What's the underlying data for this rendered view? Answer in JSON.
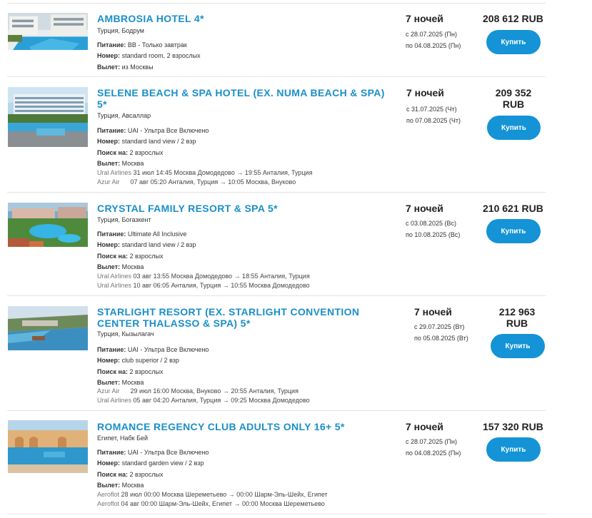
{
  "labels": {
    "meal": "Питание:",
    "room": "Номер:",
    "search": "Поиск на:",
    "departure": "Вылет:"
  },
  "hotels": [
    {
      "title": "AMBROSIA HOTEL 4*",
      "location": "Турция, Бодрум",
      "meal": "BB - Только завтрак",
      "room": "standard room, 2 взрослых",
      "departure": "из Москвы",
      "nights": "7 ночей",
      "date_from": "с 28.07.2025 (Пн)",
      "date_to": "по 04.08.2025 (Пн)",
      "price": "208 612 RUB",
      "buy_label": "Купить",
      "image_icon": "hotel-pool-photo"
    },
    {
      "title": "SELENE BEACH & SPA HOTEL (EX. NUMA BEACH & SPA) 5*",
      "location": "Турция, Авсаллар",
      "meal": "UAI - Ультра Все Включено",
      "room": "standard land view / 2 взр",
      "search": "2 взрослых",
      "departure": "Москва",
      "flights": [
        {
          "airline": "Ural Airlines",
          "text": "31 июл 14:45 Москва Домодедово → 19:55 Анталия, Турция"
        },
        {
          "airline": "Azur Air",
          "text": "07 авг 05:20 Анталия, Турция → 10:05 Москва, Внуково"
        }
      ],
      "nights": "7 ночей",
      "date_from": "с 31.07.2025 (Чт)",
      "date_to": "по 07.08.2025 (Чт)",
      "price_line1": "209 352",
      "price_line2": "RUB",
      "buy_label": "Купить",
      "image_icon": "hotel-beach-photo"
    },
    {
      "title": "CRYSTAL FAMILY RESORT & SPA 5*",
      "location": "Турция, Богазкент",
      "meal": "Ultimate All Inclusive",
      "room": "standard land view / 2 взр",
      "search": "2 взрослых",
      "departure": "Москва",
      "flights": [
        {
          "airline": "Ural Airlines",
          "text": "03 авг 13:55 Москва Домодедово → 18:55 Анталия, Турция"
        },
        {
          "airline": "Ural Airlines",
          "text": "10 авг 06:05 Анталия, Турция → 10:55 Москва Домодедово"
        }
      ],
      "nights": "7 ночей",
      "date_from": "с 03.08.2025 (Вс)",
      "date_to": "по 10.08.2025 (Вс)",
      "price": "210 621 RUB",
      "buy_label": "Купить",
      "image_icon": "resort-aerial-photo"
    },
    {
      "title": "STARLIGHT RESORT (EX. STARLIGHT CONVENTION CENTER THALASSO & SPA) 5*",
      "location": "Турция, Кызылагач",
      "meal": "UAI - Ультра Все Включено",
      "room": "club superior / 2 взр",
      "search": "2 взрослых",
      "departure": "Москва",
      "flights": [
        {
          "airline": "Azur Air",
          "text": "29 июл 16:00 Москва, Внуково → 20:55 Анталия, Турция"
        },
        {
          "airline": "Ural Airlines",
          "text": "05 авг 04:20 Анталия, Турция → 09:25 Москва Домодедово"
        }
      ],
      "nights": "7 ночей",
      "date_from": "с 29.07.2025 (Вт)",
      "date_to": "по 05.08.2025 (Вт)",
      "price_line1": "212 963",
      "price_line2": "RUB",
      "buy_label": "Купить",
      "image_icon": "coast-aerial-photo"
    },
    {
      "title": "ROMANCE REGENCY CLUB ADULTS ONLY 16+ 5*",
      "location": "Египет, Набк Бей",
      "meal": "UAI - Ультра Все Включено",
      "room": "standard garden view / 2 взр",
      "search": "2 взрослых",
      "departure": "Москва",
      "flights": [
        {
          "airline": "Aeroflot",
          "text": "28 июл 00:00 Москва Шереметьево → 00:00 Шарм-Эль-Шейх, Египет"
        },
        {
          "airline": "Aeroflot",
          "text": "04 авг 00:00 Шарм-Эль-Шейх, Египет → 00:00 Москва Шереметьево"
        }
      ],
      "nights": "7 ночей",
      "date_from": "с 28.07.2025 (Пн)",
      "date_to": "по 04.08.2025 (Пн)",
      "price": "157 320 RUB",
      "buy_label": "Купить",
      "image_icon": "egypt-pool-photo"
    }
  ]
}
